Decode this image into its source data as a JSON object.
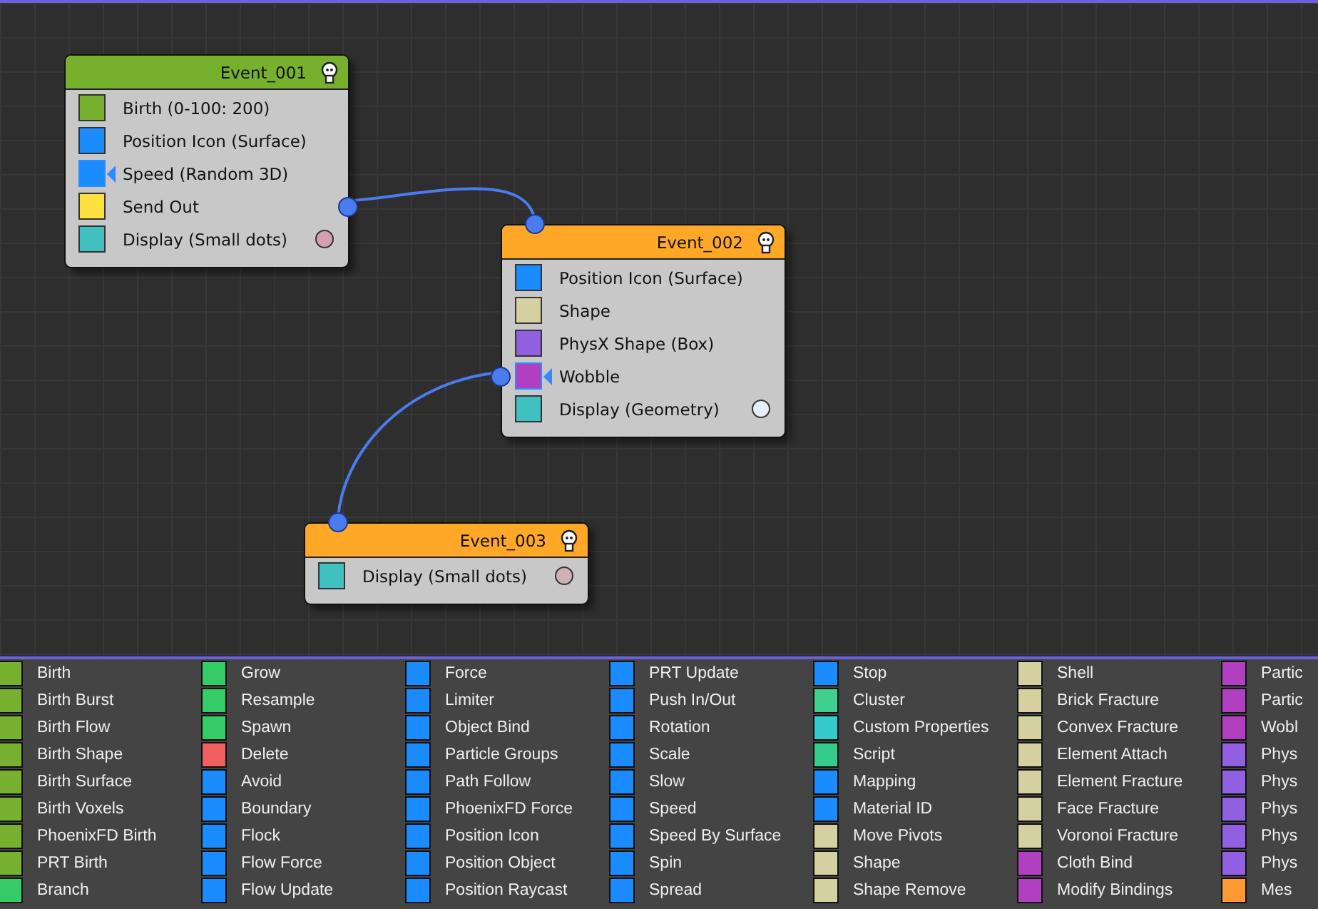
{
  "nodes": [
    {
      "title": "Event_001",
      "color": "#77b02c",
      "input_connected": false,
      "items": [
        {
          "label": "Birth (0-100: 200)",
          "kind": "operator",
          "color": "#78b030"
        },
        {
          "label": "Position Icon (Surface)",
          "kind": "operator",
          "color": "#1a8cff"
        },
        {
          "label": "Speed (Random 3D)",
          "kind": "test",
          "connected": false,
          "color": "#1a8cff"
        },
        {
          "label": "Send Out",
          "kind": "output",
          "connected": true,
          "color": "#ffe040"
        },
        {
          "label": "Display (Small dots)",
          "kind": "display",
          "color": "#40c0c0",
          "swatch": {
            "color": "#d4a0b0"
          }
        }
      ]
    },
    {
      "title": "Event_002",
      "color": "#ffa726",
      "input_connected": true,
      "items": [
        {
          "label": "Position Icon (Surface)",
          "kind": "operator",
          "color": "#1a8cff"
        },
        {
          "label": "Shape",
          "kind": "operator",
          "color": "#d4d0a0"
        },
        {
          "label": "PhysX Shape (Box)",
          "kind": "operator",
          "color": "#9060e0"
        },
        {
          "label": "Wobble",
          "kind": "test",
          "connected": true,
          "color": "#b040c0"
        },
        {
          "label": "Display (Geometry)",
          "kind": "display",
          "color": "#40c0c0",
          "swatch": {
            "color": "#e8eef8"
          }
        }
      ]
    },
    {
      "title": "Event_003",
      "color": "#ffa726",
      "input_connected": true,
      "items": [
        {
          "label": "Display (Small dots)",
          "kind": "display",
          "color": "#40c0c0",
          "swatch": {
            "color": "#d0b0b0"
          }
        }
      ]
    }
  ],
  "depot": {
    "columns": [
      {
        "items": [
          {
            "label": "Birth",
            "color": "#78b030"
          },
          {
            "label": "Birth Burst",
            "color": "#78b030"
          },
          {
            "label": "Birth Flow",
            "color": "#78b030"
          },
          {
            "label": "Birth Shape",
            "color": "#78b030"
          },
          {
            "label": "Birth Surface",
            "color": "#78b030"
          },
          {
            "label": "Birth Voxels",
            "color": "#78b030"
          },
          {
            "label": "PhoenixFD Birth",
            "color": "#78b030"
          },
          {
            "label": "PRT Birth",
            "color": "#78b030"
          },
          {
            "label": "Branch",
            "color": "#33cc66"
          }
        ]
      },
      {
        "items": [
          {
            "label": "Grow",
            "color": "#33cc66"
          },
          {
            "label": "Resample",
            "color": "#33cc66"
          },
          {
            "label": "Spawn",
            "color": "#33cc66"
          },
          {
            "label": "Delete",
            "color": "#f06060"
          },
          {
            "label": "Avoid",
            "color": "#1a8cff"
          },
          {
            "label": "Boundary",
            "color": "#1a8cff"
          },
          {
            "label": "Flock",
            "color": "#1a8cff"
          },
          {
            "label": "Flow Force",
            "color": "#1a8cff"
          },
          {
            "label": "Flow Update",
            "color": "#1a8cff"
          }
        ]
      },
      {
        "items": [
          {
            "label": "Force",
            "color": "#1a8cff"
          },
          {
            "label": "Limiter",
            "color": "#1a8cff"
          },
          {
            "label": "Object Bind",
            "color": "#1a8cff"
          },
          {
            "label": "Particle Groups",
            "color": "#1a8cff"
          },
          {
            "label": "Path Follow",
            "color": "#1a8cff"
          },
          {
            "label": "PhoenixFD Force",
            "color": "#1a8cff"
          },
          {
            "label": "Position Icon",
            "color": "#1a8cff"
          },
          {
            "label": "Position Object",
            "color": "#1a8cff"
          },
          {
            "label": "Position Raycast",
            "color": "#1a8cff"
          }
        ]
      },
      {
        "items": [
          {
            "label": "PRT Update",
            "color": "#1a8cff"
          },
          {
            "label": "Push In/Out",
            "color": "#1a8cff"
          },
          {
            "label": "Rotation",
            "color": "#1a8cff"
          },
          {
            "label": "Scale",
            "color": "#1a8cff"
          },
          {
            "label": "Slow",
            "color": "#1a8cff"
          },
          {
            "label": "Speed",
            "color": "#1a8cff"
          },
          {
            "label": "Speed By Surface",
            "color": "#1a8cff"
          },
          {
            "label": "Spin",
            "color": "#1a8cff"
          },
          {
            "label": "Spread",
            "color": "#1a8cff"
          }
        ]
      },
      {
        "items": [
          {
            "label": "Stop",
            "color": "#1a8cff"
          },
          {
            "label": "Cluster",
            "color": "#40d090"
          },
          {
            "label": "Custom Properties",
            "color": "#33cccc"
          },
          {
            "label": "Script",
            "color": "#33cc88"
          },
          {
            "label": "Mapping",
            "color": "#1a8cff"
          },
          {
            "label": "Material ID",
            "color": "#1a8cff"
          },
          {
            "label": "Move Pivots",
            "color": "#d4d0a0"
          },
          {
            "label": "Shape",
            "color": "#d4d0a0"
          },
          {
            "label": "Shape Remove",
            "color": "#d4d0a0"
          }
        ]
      },
      {
        "items": [
          {
            "label": "Shell",
            "color": "#d4d0a0"
          },
          {
            "label": "Brick Fracture",
            "color": "#d4d0a0"
          },
          {
            "label": "Convex Fracture",
            "color": "#d4d0a0"
          },
          {
            "label": "Element Attach",
            "color": "#d4d0a0"
          },
          {
            "label": "Element Fracture",
            "color": "#d4d0a0"
          },
          {
            "label": "Face Fracture",
            "color": "#d4d0a0"
          },
          {
            "label": "Voronoi Fracture",
            "color": "#d4d0a0"
          },
          {
            "label": "Cloth Bind",
            "color": "#b040c0"
          },
          {
            "label": "Modify Bindings",
            "color": "#b040c0"
          }
        ]
      },
      {
        "items": [
          {
            "label": "Partic",
            "color": "#b040c0"
          },
          {
            "label": "Partic",
            "color": "#b040c0"
          },
          {
            "label": "Wobl",
            "color": "#b040c0"
          },
          {
            "label": "Phys",
            "color": "#9060e0"
          },
          {
            "label": "Phys",
            "color": "#9060e0"
          },
          {
            "label": "Phys",
            "color": "#9060e0"
          },
          {
            "label": "Phys",
            "color": "#9060e0"
          },
          {
            "label": "Phys",
            "color": "#9060e0"
          },
          {
            "label": "Mes",
            "color": "#ff9933"
          }
        ]
      }
    ]
  }
}
